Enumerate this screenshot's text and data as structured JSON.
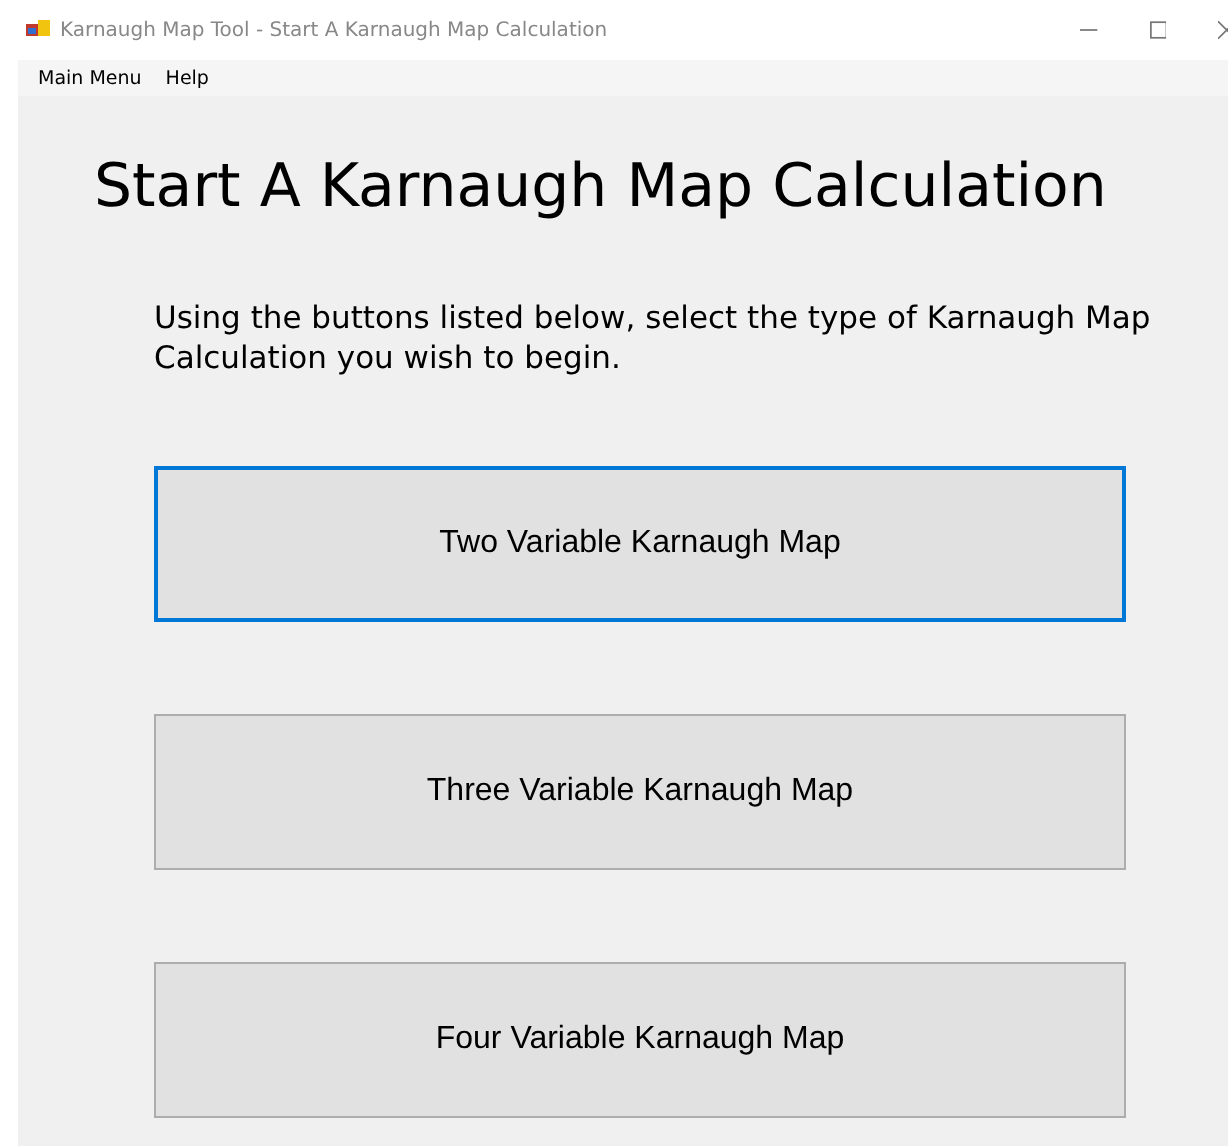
{
  "window": {
    "title": "Karnaugh Map Tool - Start A Karnaugh Map Calculation"
  },
  "menu": [
    "Main Menu",
    "Help"
  ],
  "heading": "Start A Karnaugh Map Calculation",
  "instructions": "Using the buttons listed below, select the type of Karnaugh Map Calculation you wish to begin.",
  "buttons": [
    {
      "label": "Two Variable Karnaugh Map",
      "focused": true
    },
    {
      "label": "Three Variable Karnaugh Map",
      "focused": false
    },
    {
      "label": "Four Variable Karnaugh Map",
      "focused": false
    }
  ]
}
